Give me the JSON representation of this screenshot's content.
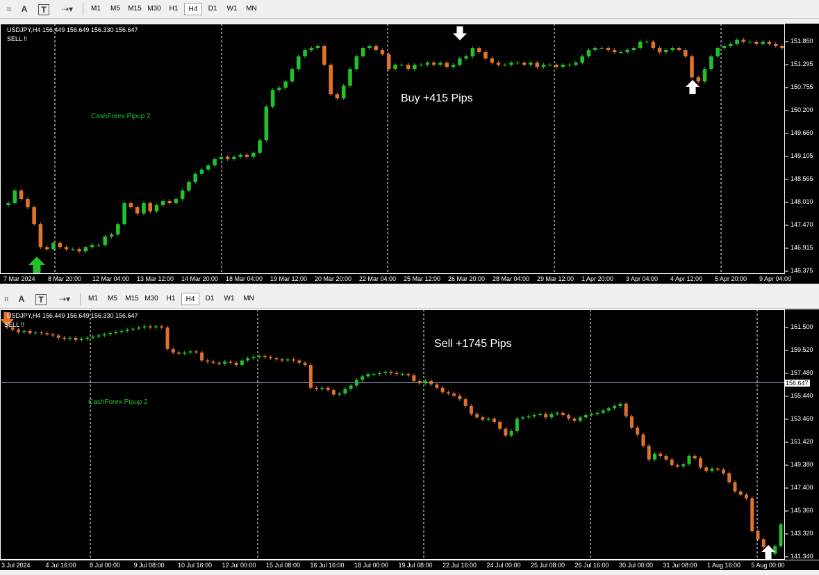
{
  "toolbar": {
    "timeframes": [
      "M1",
      "M5",
      "M15",
      "M30",
      "H1",
      "H4",
      "D1",
      "W1",
      "MN"
    ],
    "active_timeframe": "H4",
    "tool_icons": [
      "crosshair-icon",
      "text-icon",
      "text-label-icon",
      "shapes-icon"
    ]
  },
  "colors": {
    "bull": "#22c02a",
    "bear": "#e0732a",
    "background": "#000000",
    "grid": "#ffffff",
    "arrow": "#ffffff",
    "buy_arrow": "#22c02a",
    "sell_arrow": "#e0732a"
  },
  "chart_top": {
    "symbol_line": "USDJPY,H4  156.449 156.649 156.330 156.647",
    "signal_text": "SELL !!",
    "watermark": "CashForex Pipup 2",
    "result_text": "Buy +415 Pips",
    "price_labels": [
      "151.850",
      "151.295",
      "150.755",
      "150.200",
      "149.660",
      "149.105",
      "148.565",
      "148.010",
      "147.470",
      "146.915",
      "146.375"
    ],
    "time_labels": [
      "7 Mar 2024",
      "8 Mar 20:00",
      "12 Mar 04:00",
      "13 Mar 12:00",
      "14 Mar 20:00",
      "18 Mar 04:00",
      "19 Mar 12:00",
      "20 Mar 20:00",
      "22 Mar 04:00",
      "25 Mar 12:00",
      "26 Mar 20:00",
      "28 Mar 04:00",
      "29 Mar 12:00",
      "1 Apr 20:00",
      "3 Apr 04:00",
      "4 Apr 12:00",
      "5 Apr 20:00",
      "9 Apr 04:00"
    ]
  },
  "chart_bottom": {
    "symbol_line": "USDJPY,H4  156.449 156.649 156.330 156.647",
    "signal_text": "SELL !!",
    "watermark": "CashForex Pipup 2",
    "result_text": "Sell +1745 Pips",
    "current_price": "156.647",
    "price_labels": [
      "161.500",
      "159.520",
      "157.480",
      "155.440",
      "153.460",
      "151.420",
      "149.380",
      "147.400",
      "145.360",
      "143.320",
      "141.340"
    ],
    "time_labels": [
      "3 Jul 2024",
      "4 Jul 16:00",
      "8 Jul 00:00",
      "9 Jul 08:00",
      "10 Jul 16:00",
      "12 Jul 00:00",
      "15 Jul 08:00",
      "16 Jul 16:00",
      "18 Jul 00:00",
      "19 Jul 08:00",
      "22 Jul 16:00",
      "24 Jul 00:00",
      "25 Jul 08:00",
      "26 Jul 16:00",
      "30 Jul 00:00",
      "31 Jul 08:00",
      "1 Aug 16:00",
      "5 Aug 00:00"
    ]
  },
  "chart_data": [
    {
      "type": "candlestick",
      "title": "",
      "symbol": "USDJPY",
      "timeframe": "H4",
      "ylim": [
        146.375,
        151.85
      ],
      "closes": [
        148.0,
        148.3,
        148.1,
        147.9,
        147.5,
        146.95,
        146.9,
        147.05,
        146.95,
        146.9,
        146.9,
        146.85,
        146.95,
        147.0,
        147.0,
        147.2,
        147.25,
        147.5,
        148.0,
        147.9,
        147.75,
        148.0,
        147.8,
        147.95,
        148.05,
        148.0,
        148.1,
        148.3,
        148.5,
        148.7,
        148.8,
        148.9,
        149.05,
        149.1,
        149.05,
        149.1,
        149.15,
        149.1,
        149.2,
        149.5,
        150.3,
        150.7,
        150.75,
        150.9,
        151.2,
        151.5,
        151.65,
        151.7,
        151.75,
        151.3,
        150.6,
        150.5,
        150.8,
        151.2,
        151.5,
        151.7,
        151.75,
        151.65,
        151.55,
        151.2,
        151.3,
        151.3,
        151.2,
        151.3,
        151.3,
        151.35,
        151.3,
        151.35,
        151.25,
        151.3,
        151.45,
        151.5,
        151.7,
        151.6,
        151.45,
        151.35,
        151.3,
        151.3,
        151.35,
        151.35,
        151.3,
        151.35,
        151.25,
        151.3,
        151.3,
        151.25,
        151.3,
        151.3,
        151.35,
        151.5,
        151.65,
        151.7,
        151.7,
        151.65,
        151.6,
        151.6,
        151.65,
        151.7,
        151.85,
        151.85,
        151.7,
        151.6,
        151.65,
        151.7,
        151.65,
        151.5,
        151.0,
        150.9,
        151.2,
        151.5,
        151.7,
        151.75,
        151.8,
        151.9,
        151.85,
        151.85,
        151.8,
        151.85,
        151.8,
        151.75,
        151.7
      ]
    },
    {
      "type": "candlestick",
      "title": "",
      "symbol": "USDJPY",
      "timeframe": "H4",
      "ylim": [
        141.34,
        161.5
      ],
      "current_price": 156.647,
      "closes": [
        161.5,
        161.3,
        161.1,
        161.2,
        161.0,
        161.05,
        161.0,
        160.9,
        160.8,
        160.6,
        160.5,
        160.6,
        160.4,
        160.5,
        160.6,
        160.7,
        160.8,
        160.9,
        161.0,
        161.1,
        161.2,
        161.3,
        161.4,
        161.5,
        161.6,
        161.5,
        161.6,
        161.5,
        159.6,
        159.3,
        159.2,
        159.3,
        159.4,
        159.3,
        158.6,
        158.5,
        158.4,
        158.3,
        158.5,
        158.4,
        158.2,
        158.6,
        158.8,
        158.9,
        159.0,
        158.9,
        158.8,
        158.7,
        158.6,
        158.7,
        158.6,
        158.4,
        158.2,
        156.2,
        156.1,
        156.2,
        156.0,
        155.6,
        155.7,
        156.1,
        156.4,
        156.9,
        157.2,
        157.4,
        157.4,
        157.5,
        157.6,
        157.5,
        157.4,
        157.4,
        157.3,
        156.8,
        156.6,
        156.8,
        156.5,
        156.2,
        155.8,
        155.7,
        155.5,
        155.2,
        154.6,
        153.9,
        153.6,
        153.4,
        153.5,
        153.2,
        152.6,
        152.0,
        152.4,
        153.5,
        153.6,
        153.7,
        153.8,
        153.9,
        153.6,
        153.9,
        154.0,
        153.8,
        153.5,
        153.3,
        153.6,
        153.8,
        153.9,
        154.0,
        154.2,
        154.4,
        154.6,
        154.8,
        153.7,
        152.7,
        152.1,
        151.1,
        149.9,
        150.4,
        150.2,
        149.9,
        149.4,
        149.3,
        149.5,
        150.2,
        150.0,
        149.2,
        148.9,
        149.1,
        149.0,
        148.7,
        147.9,
        147.1,
        146.8,
        146.5,
        143.6,
        142.9,
        142.2,
        141.6,
        142.3,
        144.2
      ]
    }
  ]
}
